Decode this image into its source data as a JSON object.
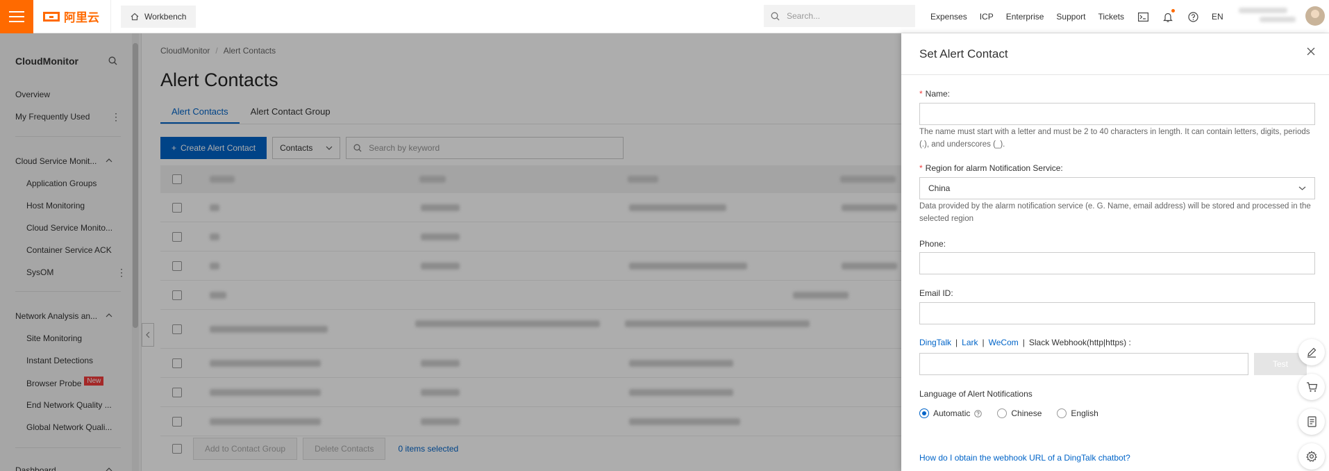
{
  "topbar": {
    "logo_text": "阿里云",
    "workbench_label": "Workbench",
    "search_placeholder": "Search...",
    "links": [
      "Expenses",
      "ICP",
      "Enterprise",
      "Support",
      "Tickets"
    ],
    "language": "EN"
  },
  "sidebar": {
    "title": "CloudMonitor",
    "items": {
      "overview": "Overview",
      "frequently_used": "My Frequently Used",
      "cloud_service_group": "Cloud Service Monit...",
      "application_groups": "Application Groups",
      "host_monitoring": "Host Monitoring",
      "cloud_service_monitoring": "Cloud Service Monito...",
      "container_service": "Container Service ACK",
      "sysom": "SysOM",
      "network_analysis_group": "Network Analysis an...",
      "site_monitoring": "Site Monitoring",
      "instant_detections": "Instant Detections",
      "browser_probe": "Browser Probe",
      "browser_probe_badge": "New",
      "end_network_quality": "End Network Quality ...",
      "global_network_quality": "Global Network Quali...",
      "dashboard": "Dashboard"
    }
  },
  "main": {
    "breadcrumb": [
      "CloudMonitor",
      "Alert Contacts"
    ],
    "breadcrumb_sep": "/",
    "page_title": "Alert Contacts",
    "tabs": [
      "Alert Contacts",
      "Alert Contact Group"
    ],
    "create_button": "Create Alert Contact",
    "contacts_select": "Contacts",
    "keyword_placeholder": "Search by keyword",
    "add_to_group_button": "Add to Contact Group",
    "delete_button": "Delete Contacts",
    "selected_count": "0 items selected"
  },
  "drawer": {
    "title": "Set Alert Contact",
    "name_label": "Name:",
    "name_help": "The name must start with a letter and must be 2 to 40 characters in length. It can contain letters, digits, periods (.), and underscores (_).",
    "region_label": "Region for alarm Notification Service:",
    "region_value": "China",
    "region_help": "Data provided by the alarm notification service (e. G. Name, email address) will be stored and processed in the selected region",
    "phone_label": "Phone:",
    "email_label": "Email ID:",
    "webhook_links": [
      "DingTalk",
      "Lark",
      "WeCom"
    ],
    "webhook_sep": "|",
    "webhook_slack": "Slack Webhook(http|https) :",
    "test_button": "Test",
    "language_label": "Language of Alert Notifications",
    "language_options": [
      "Automatic",
      "Chinese",
      "English"
    ],
    "language_selected": "Automatic",
    "help_link": "How do I obtain the webhook URL of a DingTalk chatbot?"
  },
  "colors": {
    "brand_orange": "#ff6a00",
    "primary_blue": "#0064c8",
    "required_red": "#f23c3c"
  }
}
